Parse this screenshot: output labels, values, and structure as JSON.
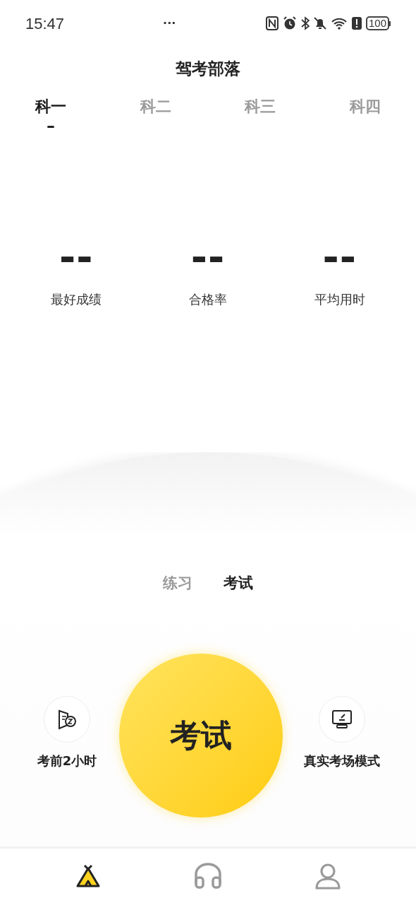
{
  "status_bar": {
    "time": "15:47",
    "more": "···",
    "battery": "100"
  },
  "title": "驾考部落",
  "subject_tabs": [
    {
      "label": "科一",
      "selected": true
    },
    {
      "label": "科二",
      "selected": false
    },
    {
      "label": "科三",
      "selected": false
    },
    {
      "label": "科四",
      "selected": false
    }
  ],
  "stats": [
    {
      "value": "--",
      "label": "最好成绩"
    },
    {
      "value": "--",
      "label": "合格率"
    },
    {
      "value": "--",
      "label": "平均用时"
    }
  ],
  "mode_tabs": [
    {
      "label": "练习",
      "selected": false
    },
    {
      "label": "考试",
      "selected": true
    }
  ],
  "side_actions": [
    {
      "kind": "timer",
      "label": "考前2小时"
    },
    {
      "kind": "monitor",
      "label": "真实考场模式"
    }
  ],
  "start_button": "考试",
  "bottom_nav": [
    {
      "kind": "tent",
      "selected": true
    },
    {
      "kind": "headphones",
      "selected": false
    },
    {
      "kind": "person",
      "selected": false
    }
  ]
}
